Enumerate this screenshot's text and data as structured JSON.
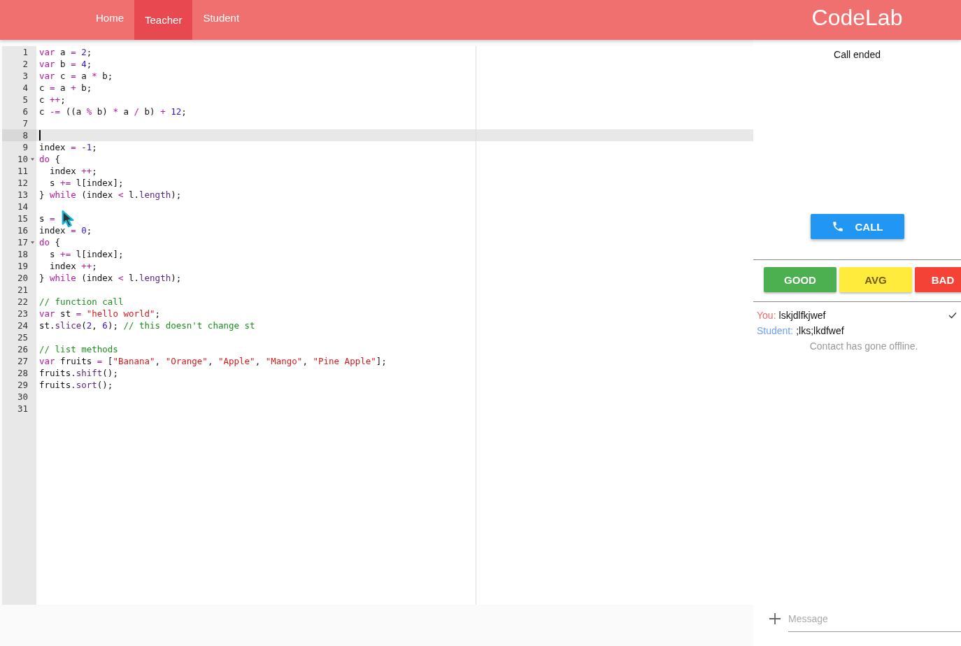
{
  "nav": {
    "tabs": [
      {
        "label": "Home",
        "selected": false
      },
      {
        "label": "Teacher",
        "selected": true
      },
      {
        "label": "Student",
        "selected": false
      }
    ],
    "logo": "CodeLab"
  },
  "editor": {
    "lines": [
      {
        "number": "1",
        "tokens": [
          {
            "text": "var",
            "kind": "kw"
          },
          {
            "text": " a ",
            "kind": "plain"
          },
          {
            "text": "= ",
            "kind": "op"
          },
          {
            "text": "2",
            "kind": "num"
          },
          {
            "text": ";",
            "kind": "plain"
          }
        ]
      },
      {
        "number": "2",
        "tokens": [
          {
            "text": "var",
            "kind": "kw"
          },
          {
            "text": " b ",
            "kind": "plain"
          },
          {
            "text": "= ",
            "kind": "op"
          },
          {
            "text": "4",
            "kind": "num"
          },
          {
            "text": ";",
            "kind": "plain"
          }
        ]
      },
      {
        "number": "3",
        "tokens": [
          {
            "text": "var",
            "kind": "kw"
          },
          {
            "text": " c ",
            "kind": "plain"
          },
          {
            "text": "=",
            "kind": "op"
          },
          {
            "text": " a ",
            "kind": "plain"
          },
          {
            "text": "*",
            "kind": "op"
          },
          {
            "text": " b;",
            "kind": "plain"
          }
        ]
      },
      {
        "number": "4",
        "tokens": [
          {
            "text": "c ",
            "kind": "plain"
          },
          {
            "text": "=",
            "kind": "op"
          },
          {
            "text": " a ",
            "kind": "plain"
          },
          {
            "text": "+",
            "kind": "op"
          },
          {
            "text": " b;",
            "kind": "plain"
          }
        ]
      },
      {
        "number": "5",
        "tokens": [
          {
            "text": "c ",
            "kind": "plain"
          },
          {
            "text": "++",
            "kind": "op"
          },
          {
            "text": ";",
            "kind": "plain"
          }
        ]
      },
      {
        "number": "6",
        "tokens": [
          {
            "text": "c ",
            "kind": "plain"
          },
          {
            "text": "-=",
            "kind": "op"
          },
          {
            "text": " ((a ",
            "kind": "plain"
          },
          {
            "text": "%",
            "kind": "op"
          },
          {
            "text": " b) ",
            "kind": "plain"
          },
          {
            "text": "*",
            "kind": "op"
          },
          {
            "text": " a ",
            "kind": "plain"
          },
          {
            "text": "/",
            "kind": "op"
          },
          {
            "text": " b) ",
            "kind": "plain"
          },
          {
            "text": "+ ",
            "kind": "op"
          },
          {
            "text": "12",
            "kind": "num"
          },
          {
            "text": ";",
            "kind": "plain"
          }
        ]
      },
      {
        "number": "7"
      },
      {
        "number": "8",
        "active": true
      },
      {
        "number": "9",
        "tokens": [
          {
            "text": "index ",
            "kind": "plain"
          },
          {
            "text": "= ",
            "kind": "op"
          },
          {
            "text": "-1",
            "kind": "num"
          },
          {
            "text": ";",
            "kind": "plain"
          }
        ]
      },
      {
        "number": "10",
        "fold": true,
        "tokens": [
          {
            "text": "do",
            "kind": "kw"
          },
          {
            "text": " {",
            "kind": "plain"
          }
        ]
      },
      {
        "number": "11",
        "tokens": [
          {
            "text": "  index ",
            "kind": "plain"
          },
          {
            "text": "++",
            "kind": "op"
          },
          {
            "text": ";",
            "kind": "plain"
          }
        ]
      },
      {
        "number": "12",
        "tokens": [
          {
            "text": "  s ",
            "kind": "plain"
          },
          {
            "text": "+=",
            "kind": "op"
          },
          {
            "text": " l[index];",
            "kind": "plain"
          }
        ]
      },
      {
        "number": "13",
        "tokens": [
          {
            "text": "} ",
            "kind": "plain"
          },
          {
            "text": "while",
            "kind": "kw"
          },
          {
            "text": " (index ",
            "kind": "plain"
          },
          {
            "text": "<",
            "kind": "op"
          },
          {
            "text": " l.",
            "kind": "plain"
          },
          {
            "text": "length",
            "kind": "prop"
          },
          {
            "text": ");",
            "kind": "plain"
          }
        ]
      },
      {
        "number": "14"
      },
      {
        "number": "15",
        "tokens": [
          {
            "text": "s ",
            "kind": "plain"
          },
          {
            "text": "=",
            "kind": "op"
          }
        ]
      },
      {
        "number": "16",
        "tokens": [
          {
            "text": "index ",
            "kind": "plain"
          },
          {
            "text": "= ",
            "kind": "op"
          },
          {
            "text": "0",
            "kind": "num"
          },
          {
            "text": ";",
            "kind": "plain"
          }
        ]
      },
      {
        "number": "17",
        "fold": true,
        "tokens": [
          {
            "text": "do",
            "kind": "kw"
          },
          {
            "text": " {",
            "kind": "plain"
          }
        ]
      },
      {
        "number": "18",
        "tokens": [
          {
            "text": "  s ",
            "kind": "plain"
          },
          {
            "text": "+=",
            "kind": "op"
          },
          {
            "text": " l[index];",
            "kind": "plain"
          }
        ]
      },
      {
        "number": "19",
        "tokens": [
          {
            "text": "  index ",
            "kind": "plain"
          },
          {
            "text": "++",
            "kind": "op"
          },
          {
            "text": ";",
            "kind": "plain"
          }
        ]
      },
      {
        "number": "20",
        "tokens": [
          {
            "text": "} ",
            "kind": "plain"
          },
          {
            "text": "while",
            "kind": "kw"
          },
          {
            "text": " (index ",
            "kind": "plain"
          },
          {
            "text": "<",
            "kind": "op"
          },
          {
            "text": " l.",
            "kind": "plain"
          },
          {
            "text": "length",
            "kind": "prop"
          },
          {
            "text": ");",
            "kind": "plain"
          }
        ]
      },
      {
        "number": "21"
      },
      {
        "number": "22",
        "tokens": [
          {
            "text": "// function call",
            "kind": "com"
          }
        ]
      },
      {
        "number": "23",
        "tokens": [
          {
            "text": "var",
            "kind": "kw"
          },
          {
            "text": " st ",
            "kind": "plain"
          },
          {
            "text": "= ",
            "kind": "op"
          },
          {
            "text": "\"hello world\"",
            "kind": "str"
          },
          {
            "text": ";",
            "kind": "plain"
          }
        ]
      },
      {
        "number": "24",
        "tokens": [
          {
            "text": "st.",
            "kind": "plain"
          },
          {
            "text": "slice",
            "kind": "prop"
          },
          {
            "text": "(",
            "kind": "plain"
          },
          {
            "text": "2",
            "kind": "num"
          },
          {
            "text": ", ",
            "kind": "plain"
          },
          {
            "text": "6",
            "kind": "num"
          },
          {
            "text": "); ",
            "kind": "plain"
          },
          {
            "text": "// this doesn't change st",
            "kind": "com"
          }
        ]
      },
      {
        "number": "25"
      },
      {
        "number": "26",
        "tokens": [
          {
            "text": "// list methods",
            "kind": "com"
          }
        ]
      },
      {
        "number": "27",
        "tokens": [
          {
            "text": "var",
            "kind": "kw"
          },
          {
            "text": " fruits ",
            "kind": "plain"
          },
          {
            "text": "=",
            "kind": "op"
          },
          {
            "text": " [",
            "kind": "plain"
          },
          {
            "text": "\"Banana\"",
            "kind": "str"
          },
          {
            "text": ", ",
            "kind": "plain"
          },
          {
            "text": "\"Orange\"",
            "kind": "str"
          },
          {
            "text": ", ",
            "kind": "plain"
          },
          {
            "text": "\"Apple\"",
            "kind": "str"
          },
          {
            "text": ", ",
            "kind": "plain"
          },
          {
            "text": "\"Mango\"",
            "kind": "str"
          },
          {
            "text": ", ",
            "kind": "plain"
          },
          {
            "text": "\"Pine Apple\"",
            "kind": "str"
          },
          {
            "text": "];",
            "kind": "plain"
          }
        ]
      },
      {
        "number": "28",
        "tokens": [
          {
            "text": "fruits.",
            "kind": "plain"
          },
          {
            "text": "shift",
            "kind": "prop"
          },
          {
            "text": "();",
            "kind": "plain"
          }
        ]
      },
      {
        "number": "29",
        "tokens": [
          {
            "text": "fruits.",
            "kind": "plain"
          },
          {
            "text": "sort",
            "kind": "prop"
          },
          {
            "text": "();",
            "kind": "plain"
          }
        ]
      },
      {
        "number": "30"
      },
      {
        "number": "31"
      }
    ]
  },
  "call": {
    "status": "Call ended",
    "button": "CALL"
  },
  "ratings": [
    {
      "label": "GOOD",
      "color": "#4caf50"
    },
    {
      "label": "AVG",
      "color": "#ffeb3b"
    },
    {
      "label": "BAD",
      "color": "#f44336"
    }
  ],
  "chat": {
    "messages": [
      {
        "sender": "You:",
        "text": "lskjdlfkjwef",
        "color": "#f26a6a",
        "delivered": true
      },
      {
        "sender": "Student:",
        "text": ";lks;lkdfwef",
        "color": "#6fa0f2",
        "delivered": false
      }
    ],
    "notice": "Contact has gone offline.",
    "placeholder": "Message"
  }
}
